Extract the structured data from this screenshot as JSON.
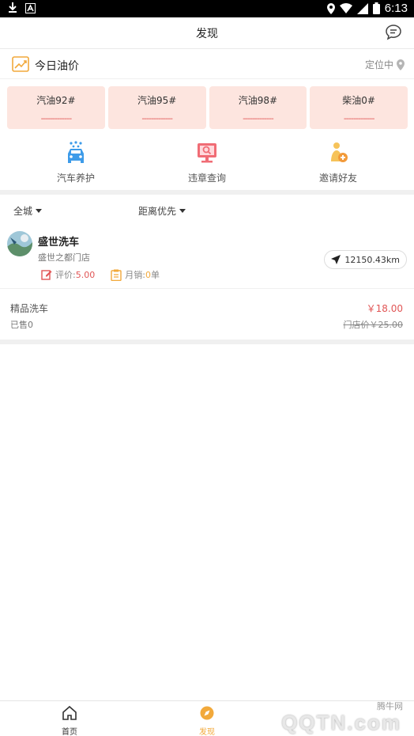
{
  "status_bar": {
    "time": "6:13",
    "icons": [
      "download-icon",
      "a-icon",
      "location-icon",
      "wifi-icon",
      "signal-icon",
      "battery-icon"
    ]
  },
  "header": {
    "title": "发现",
    "right_icon": "message-icon"
  },
  "oil": {
    "title": "今日油价",
    "location_text": "定位中",
    "prices": [
      {
        "name": "汽油92#",
        "value": "-------------"
      },
      {
        "name": "汽油95#",
        "value": "-------------"
      },
      {
        "name": "汽油98#",
        "value": "-------------"
      },
      {
        "name": "柴油0#",
        "value": "-------------"
      }
    ]
  },
  "actions": [
    {
      "label": "汽车养护",
      "icon": "car-wash-icon"
    },
    {
      "label": "违章查询",
      "icon": "violation-search-icon"
    },
    {
      "label": "邀请好友",
      "icon": "invite-friend-icon"
    }
  ],
  "filters": {
    "area": "全城",
    "sort": "距离优先"
  },
  "store": {
    "name": "盛世洗车",
    "branch": "盛世之都门店",
    "rating_label": "评价:",
    "rating_value": "5.00",
    "sales_label": "月销:",
    "sales_value": "0",
    "sales_unit": "单",
    "distance": "12150.43km"
  },
  "product": {
    "name": "精品洗车",
    "sold": "已售0",
    "price": "￥18.00",
    "original_price": "门店价￥25.00"
  },
  "tabbar": {
    "tabs": [
      {
        "label": "首页",
        "icon": "home-icon"
      },
      {
        "label": "发现",
        "icon": "compass-icon"
      }
    ],
    "active": 1
  },
  "watermark": {
    "text": "腾牛网",
    "logo": "QQTN.com"
  },
  "colors": {
    "accent": "#f2a93b",
    "price_red": "#e15656",
    "card_bg": "#fde5df"
  }
}
